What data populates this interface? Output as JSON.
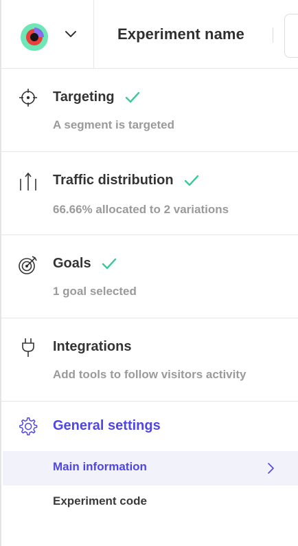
{
  "header": {
    "logo_icon": "target-logo-icon",
    "menu_icon": "chevron-down-icon",
    "title": "Experiment name"
  },
  "sections": [
    {
      "title": "Targeting",
      "subtitle": "A segment is targeted",
      "icon": "crosshair-icon",
      "completed": true
    },
    {
      "title": "Traffic distribution",
      "subtitle": "66.66% allocated to 2 variations",
      "icon": "traffic-arrows-icon",
      "completed": true
    },
    {
      "title": "Goals",
      "subtitle": "1 goal selected",
      "icon": "dartboard-icon",
      "completed": true
    },
    {
      "title": "Integrations",
      "subtitle": "Add tools to follow visitors activity",
      "icon": "plug-icon",
      "completed": false
    }
  ],
  "general_settings": {
    "title": "General settings",
    "icon": "gear-icon",
    "items": [
      {
        "label": "Main information",
        "active": true
      },
      {
        "label": "Experiment code",
        "active": false
      }
    ]
  },
  "colors": {
    "accent": "#4f46e5",
    "check": "#3cc99a",
    "muted_text": "#9a9a9a",
    "active_bg": "#f2f2fb"
  }
}
